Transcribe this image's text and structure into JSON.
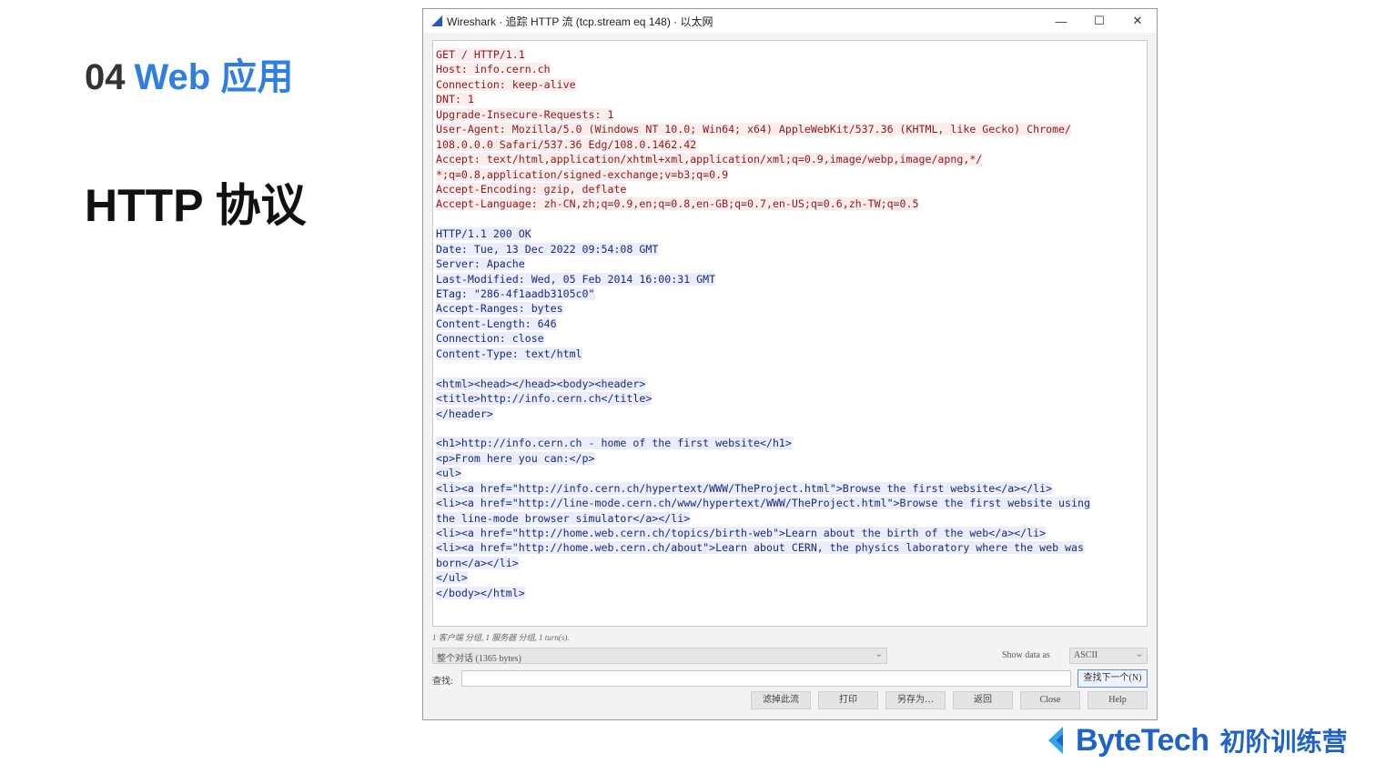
{
  "slide": {
    "section_number": "04",
    "section_name": "Web 应用",
    "title": "HTTP 协议"
  },
  "window": {
    "title": "Wireshark · 追踪 HTTP 流 (tcp.stream eq 148) · 以太网",
    "controls": {
      "minimize": "—",
      "maximize": "☐",
      "close": "✕"
    }
  },
  "request_lines": [
    "GET / HTTP/1.1",
    "Host: info.cern.ch",
    "Connection: keep-alive",
    "DNT: 1",
    "Upgrade-Insecure-Requests: 1",
    "User-Agent: Mozilla/5.0 (Windows NT 10.0; Win64; x64) AppleWebKit/537.36 (KHTML, like Gecko) Chrome/",
    "108.0.0.0 Safari/537.36 Edg/108.0.1462.42",
    "Accept: text/html,application/xhtml+xml,application/xml;q=0.9,image/webp,image/apng,*/",
    "*;q=0.8,application/signed-exchange;v=b3;q=0.9",
    "Accept-Encoding: gzip, deflate",
    "Accept-Language: zh-CN,zh;q=0.9,en;q=0.8,en-GB;q=0.7,en-US;q=0.6,zh-TW;q=0.5"
  ],
  "response_lines": [
    "HTTP/1.1 200 OK",
    "Date: Tue, 13 Dec 2022 09:54:08 GMT",
    "Server: Apache",
    "Last-Modified: Wed, 05 Feb 2014 16:00:31 GMT",
    "ETag: \"286-4f1aadb3105c0\"",
    "Accept-Ranges: bytes",
    "Content-Length: 646",
    "Connection: close",
    "Content-Type: text/html",
    "",
    "<html><head></head><body><header>",
    "<title>http://info.cern.ch</title>",
    "</header>",
    "",
    "<h1>http://info.cern.ch - home of the first website</h1>",
    "<p>From here you can:</p>",
    "<ul>",
    "<li><a href=\"http://info.cern.ch/hypertext/WWW/TheProject.html\">Browse the first website</a></li>",
    "<li><a href=\"http://line-mode.cern.ch/www/hypertext/WWW/TheProject.html\">Browse the first website using",
    "the line-mode browser simulator</a></li>",
    "<li><a href=\"http://home.web.cern.ch/topics/birth-web\">Learn about the birth of the web</a></li>",
    "<li><a href=\"http://home.web.cern.ch/about\">Learn about CERN, the physics laboratory where the web was",
    "born</a></li>",
    "</ul>",
    "</body></html>"
  ],
  "status": {
    "stats": "1 客户端 分组, 1 服务器 分组, 1 turn(s)."
  },
  "controls": {
    "conversation_select": "整个对话 (1365 bytes)",
    "show_data_label": "Show data as",
    "show_data_value": "ASCII",
    "find_label": "查找:",
    "find_value": "",
    "find_next": "查找下一个(N)",
    "buttons": [
      "滤掉此流",
      "打印",
      "另存为…",
      "返回",
      "Close",
      "Help"
    ]
  },
  "logo": {
    "brand": "ByteTech",
    "subtitle": "初阶训练营"
  },
  "colors": {
    "request_text": "#8b1a1a",
    "request_bg": "#fbeded",
    "response_text": "#1a2a7a",
    "response_bg": "#ecedfb",
    "accent": "#2e7fe0",
    "brand": "#1e63c7"
  }
}
